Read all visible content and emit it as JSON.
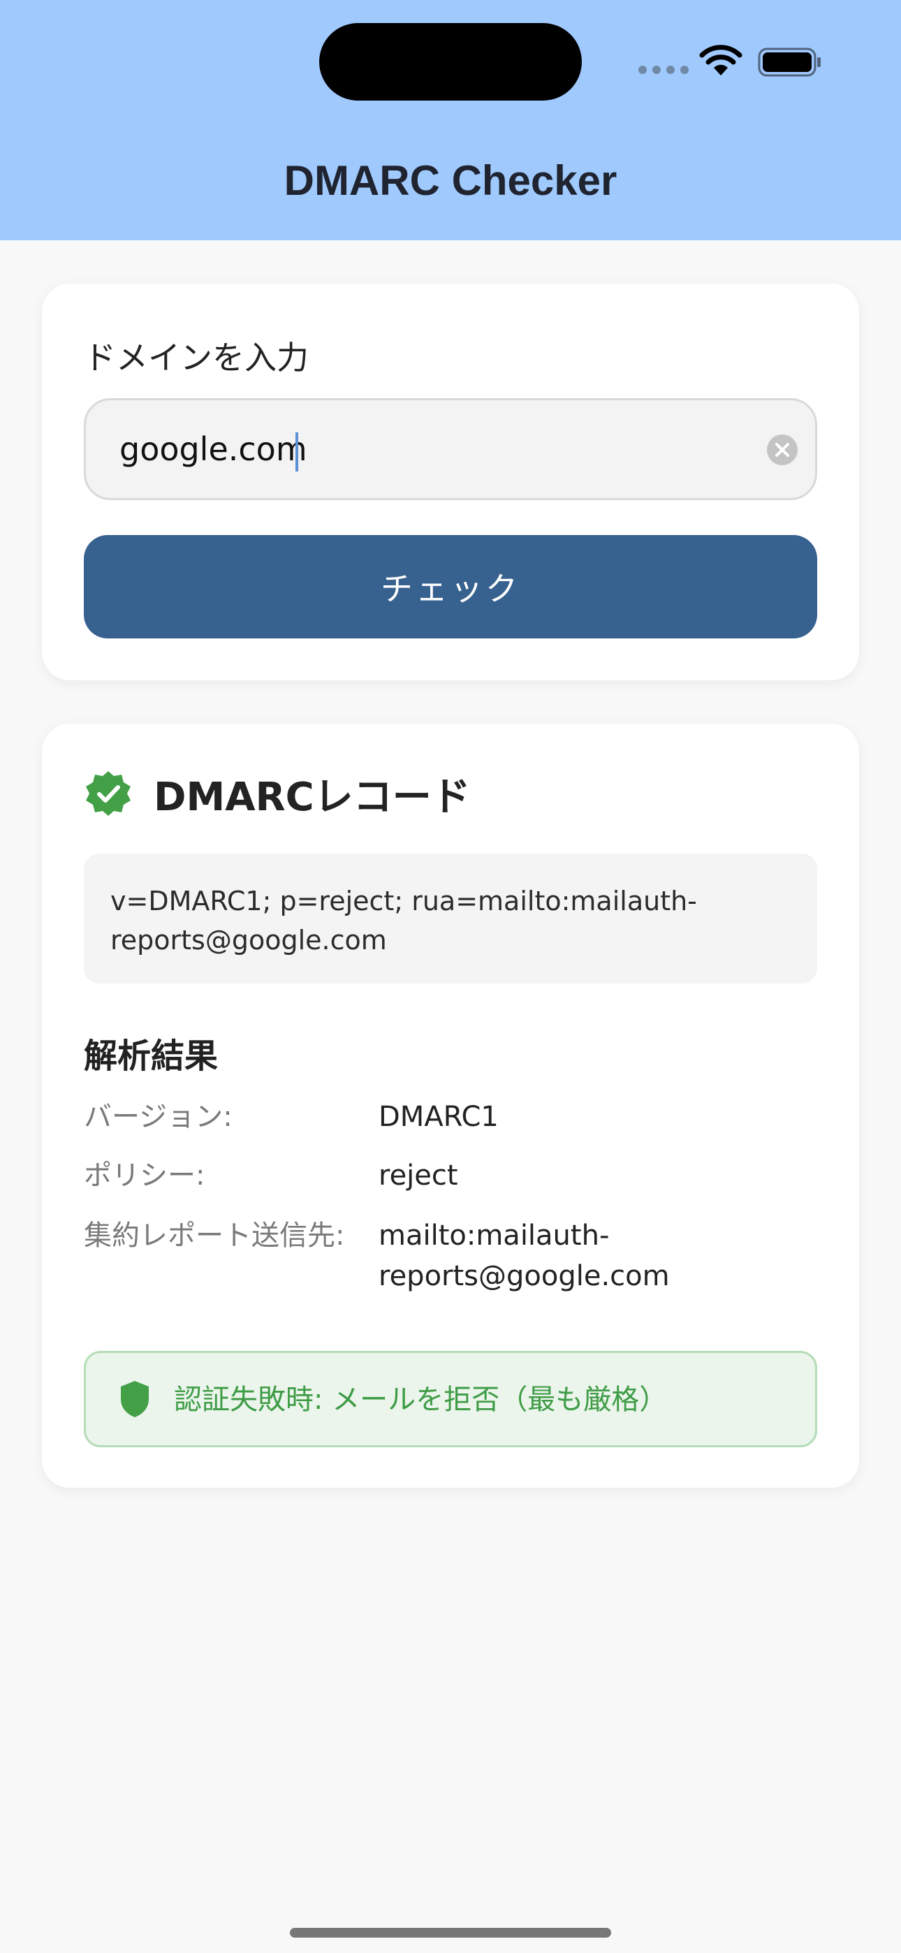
{
  "app": {
    "title": "DMARC Checker"
  },
  "input_card": {
    "label": "ドメインを入力",
    "domain_value": "google.com",
    "check_label": "チェック"
  },
  "result_card": {
    "record_title": "DMARCレコード",
    "record_text": "v=DMARC1; p=reject; rua=mailto:mailauth-reports@google.com",
    "analysis_title": "解析結果",
    "rows": [
      {
        "key": "バージョン:",
        "value": "DMARC1"
      },
      {
        "key": "ポリシー:",
        "value": "reject"
      },
      {
        "key": "集約レポート送信先:",
        "value": "mailto:mailauth-reports@google.com"
      }
    ],
    "policy_note": "認証失敗時: メールを拒否（最も厳格）"
  },
  "icons": {
    "verified": "verified-badge-icon",
    "clear": "clear-circle-icon",
    "shield": "shield-icon",
    "wifi": "wifi-icon",
    "battery": "battery-icon"
  },
  "colors": {
    "header": "#a0c9fd",
    "button": "#37618f",
    "success": "#43a047",
    "banner_bg": "#ebf5ec"
  }
}
